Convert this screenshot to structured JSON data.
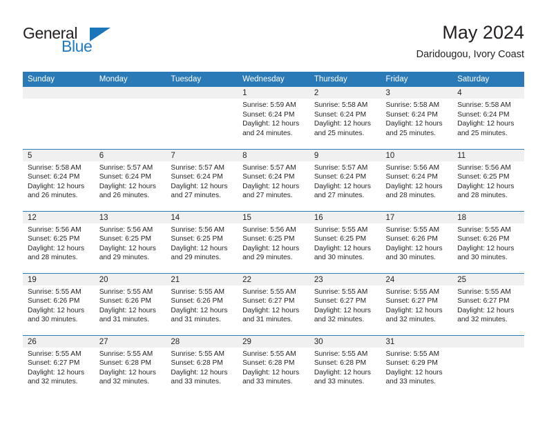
{
  "logo": {
    "word_top": "General",
    "word_bottom": "Blue",
    "accent_color": "#1b75bb"
  },
  "header": {
    "title": "May 2024",
    "subtitle": "Daridougou, Ivory Coast"
  },
  "theme": {
    "header_bg": "#2b7ab8",
    "daynum_bg": "#f0f0f0",
    "text": "#231f20"
  },
  "columns": [
    "Sunday",
    "Monday",
    "Tuesday",
    "Wednesday",
    "Thursday",
    "Friday",
    "Saturday"
  ],
  "labels": {
    "sunrise": "Sunrise:",
    "sunset": "Sunset:",
    "daylight": "Daylight:"
  },
  "weeks": [
    [
      {
        "day": "",
        "lines": []
      },
      {
        "day": "",
        "lines": []
      },
      {
        "day": "",
        "lines": []
      },
      {
        "day": "1",
        "lines": [
          "Sunrise: 5:59 AM",
          "Sunset: 6:24 PM",
          "Daylight: 12 hours and 24 minutes."
        ]
      },
      {
        "day": "2",
        "lines": [
          "Sunrise: 5:58 AM",
          "Sunset: 6:24 PM",
          "Daylight: 12 hours and 25 minutes."
        ]
      },
      {
        "day": "3",
        "lines": [
          "Sunrise: 5:58 AM",
          "Sunset: 6:24 PM",
          "Daylight: 12 hours and 25 minutes."
        ]
      },
      {
        "day": "4",
        "lines": [
          "Sunrise: 5:58 AM",
          "Sunset: 6:24 PM",
          "Daylight: 12 hours and 25 minutes."
        ]
      }
    ],
    [
      {
        "day": "5",
        "lines": [
          "Sunrise: 5:58 AM",
          "Sunset: 6:24 PM",
          "Daylight: 12 hours and 26 minutes."
        ]
      },
      {
        "day": "6",
        "lines": [
          "Sunrise: 5:57 AM",
          "Sunset: 6:24 PM",
          "Daylight: 12 hours and 26 minutes."
        ]
      },
      {
        "day": "7",
        "lines": [
          "Sunrise: 5:57 AM",
          "Sunset: 6:24 PM",
          "Daylight: 12 hours and 27 minutes."
        ]
      },
      {
        "day": "8",
        "lines": [
          "Sunrise: 5:57 AM",
          "Sunset: 6:24 PM",
          "Daylight: 12 hours and 27 minutes."
        ]
      },
      {
        "day": "9",
        "lines": [
          "Sunrise: 5:57 AM",
          "Sunset: 6:24 PM",
          "Daylight: 12 hours and 27 minutes."
        ]
      },
      {
        "day": "10",
        "lines": [
          "Sunrise: 5:56 AM",
          "Sunset: 6:24 PM",
          "Daylight: 12 hours and 28 minutes."
        ]
      },
      {
        "day": "11",
        "lines": [
          "Sunrise: 5:56 AM",
          "Sunset: 6:25 PM",
          "Daylight: 12 hours and 28 minutes."
        ]
      }
    ],
    [
      {
        "day": "12",
        "lines": [
          "Sunrise: 5:56 AM",
          "Sunset: 6:25 PM",
          "Daylight: 12 hours and 28 minutes."
        ]
      },
      {
        "day": "13",
        "lines": [
          "Sunrise: 5:56 AM",
          "Sunset: 6:25 PM",
          "Daylight: 12 hours and 29 minutes."
        ]
      },
      {
        "day": "14",
        "lines": [
          "Sunrise: 5:56 AM",
          "Sunset: 6:25 PM",
          "Daylight: 12 hours and 29 minutes."
        ]
      },
      {
        "day": "15",
        "lines": [
          "Sunrise: 5:56 AM",
          "Sunset: 6:25 PM",
          "Daylight: 12 hours and 29 minutes."
        ]
      },
      {
        "day": "16",
        "lines": [
          "Sunrise: 5:55 AM",
          "Sunset: 6:25 PM",
          "Daylight: 12 hours and 30 minutes."
        ]
      },
      {
        "day": "17",
        "lines": [
          "Sunrise: 5:55 AM",
          "Sunset: 6:26 PM",
          "Daylight: 12 hours and 30 minutes."
        ]
      },
      {
        "day": "18",
        "lines": [
          "Sunrise: 5:55 AM",
          "Sunset: 6:26 PM",
          "Daylight: 12 hours and 30 minutes."
        ]
      }
    ],
    [
      {
        "day": "19",
        "lines": [
          "Sunrise: 5:55 AM",
          "Sunset: 6:26 PM",
          "Daylight: 12 hours and 30 minutes."
        ]
      },
      {
        "day": "20",
        "lines": [
          "Sunrise: 5:55 AM",
          "Sunset: 6:26 PM",
          "Daylight: 12 hours and 31 minutes."
        ]
      },
      {
        "day": "21",
        "lines": [
          "Sunrise: 5:55 AM",
          "Sunset: 6:26 PM",
          "Daylight: 12 hours and 31 minutes."
        ]
      },
      {
        "day": "22",
        "lines": [
          "Sunrise: 5:55 AM",
          "Sunset: 6:27 PM",
          "Daylight: 12 hours and 31 minutes."
        ]
      },
      {
        "day": "23",
        "lines": [
          "Sunrise: 5:55 AM",
          "Sunset: 6:27 PM",
          "Daylight: 12 hours and 32 minutes."
        ]
      },
      {
        "day": "24",
        "lines": [
          "Sunrise: 5:55 AM",
          "Sunset: 6:27 PM",
          "Daylight: 12 hours and 32 minutes."
        ]
      },
      {
        "day": "25",
        "lines": [
          "Sunrise: 5:55 AM",
          "Sunset: 6:27 PM",
          "Daylight: 12 hours and 32 minutes."
        ]
      }
    ],
    [
      {
        "day": "26",
        "lines": [
          "Sunrise: 5:55 AM",
          "Sunset: 6:27 PM",
          "Daylight: 12 hours and 32 minutes."
        ]
      },
      {
        "day": "27",
        "lines": [
          "Sunrise: 5:55 AM",
          "Sunset: 6:28 PM",
          "Daylight: 12 hours and 32 minutes."
        ]
      },
      {
        "day": "28",
        "lines": [
          "Sunrise: 5:55 AM",
          "Sunset: 6:28 PM",
          "Daylight: 12 hours and 33 minutes."
        ]
      },
      {
        "day": "29",
        "lines": [
          "Sunrise: 5:55 AM",
          "Sunset: 6:28 PM",
          "Daylight: 12 hours and 33 minutes."
        ]
      },
      {
        "day": "30",
        "lines": [
          "Sunrise: 5:55 AM",
          "Sunset: 6:28 PM",
          "Daylight: 12 hours and 33 minutes."
        ]
      },
      {
        "day": "31",
        "lines": [
          "Sunrise: 5:55 AM",
          "Sunset: 6:29 PM",
          "Daylight: 12 hours and 33 minutes."
        ]
      },
      {
        "day": "",
        "lines": []
      }
    ]
  ]
}
